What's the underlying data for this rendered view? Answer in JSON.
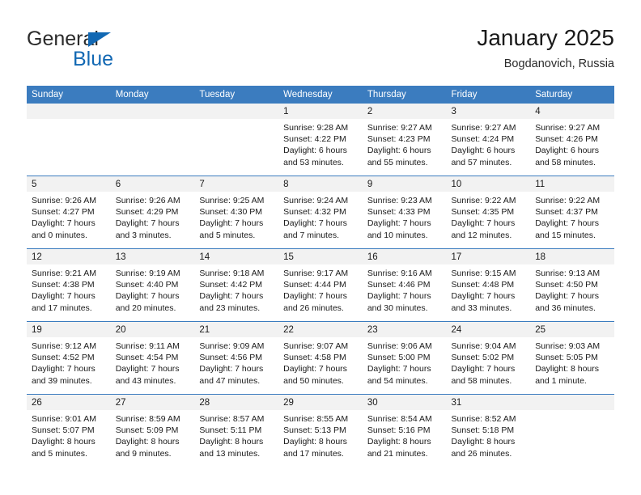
{
  "brand": {
    "name_top": "General",
    "name_bottom": "Blue",
    "color_blue": "#1268b3",
    "color_dark": "#2b2b2b"
  },
  "header": {
    "title": "January 2025",
    "subtitle": "Bogdanovich, Russia"
  },
  "theme": {
    "header_row_bg": "#3b7cbf",
    "header_row_text": "#ffffff",
    "day_band_bg": "#f2f2f2",
    "grid_line": "#3b7cbf"
  },
  "weekday_headers": [
    "Sunday",
    "Monday",
    "Tuesday",
    "Wednesday",
    "Thursday",
    "Friday",
    "Saturday"
  ],
  "weeks": [
    [
      {
        "day": "",
        "empty": true,
        "sunrise": "",
        "sunset": "",
        "daylight_1": "",
        "daylight_2": ""
      },
      {
        "day": "",
        "empty": true,
        "sunrise": "",
        "sunset": "",
        "daylight_1": "",
        "daylight_2": ""
      },
      {
        "day": "",
        "empty": true,
        "sunrise": "",
        "sunset": "",
        "daylight_1": "",
        "daylight_2": ""
      },
      {
        "day": "1",
        "empty": false,
        "sunrise": "Sunrise: 9:28 AM",
        "sunset": "Sunset: 4:22 PM",
        "daylight_1": "Daylight: 6 hours",
        "daylight_2": "and 53 minutes."
      },
      {
        "day": "2",
        "empty": false,
        "sunrise": "Sunrise: 9:27 AM",
        "sunset": "Sunset: 4:23 PM",
        "daylight_1": "Daylight: 6 hours",
        "daylight_2": "and 55 minutes."
      },
      {
        "day": "3",
        "empty": false,
        "sunrise": "Sunrise: 9:27 AM",
        "sunset": "Sunset: 4:24 PM",
        "daylight_1": "Daylight: 6 hours",
        "daylight_2": "and 57 minutes."
      },
      {
        "day": "4",
        "empty": false,
        "sunrise": "Sunrise: 9:27 AM",
        "sunset": "Sunset: 4:26 PM",
        "daylight_1": "Daylight: 6 hours",
        "daylight_2": "and 58 minutes."
      }
    ],
    [
      {
        "day": "5",
        "empty": false,
        "sunrise": "Sunrise: 9:26 AM",
        "sunset": "Sunset: 4:27 PM",
        "daylight_1": "Daylight: 7 hours",
        "daylight_2": "and 0 minutes."
      },
      {
        "day": "6",
        "empty": false,
        "sunrise": "Sunrise: 9:26 AM",
        "sunset": "Sunset: 4:29 PM",
        "daylight_1": "Daylight: 7 hours",
        "daylight_2": "and 3 minutes."
      },
      {
        "day": "7",
        "empty": false,
        "sunrise": "Sunrise: 9:25 AM",
        "sunset": "Sunset: 4:30 PM",
        "daylight_1": "Daylight: 7 hours",
        "daylight_2": "and 5 minutes."
      },
      {
        "day": "8",
        "empty": false,
        "sunrise": "Sunrise: 9:24 AM",
        "sunset": "Sunset: 4:32 PM",
        "daylight_1": "Daylight: 7 hours",
        "daylight_2": "and 7 minutes."
      },
      {
        "day": "9",
        "empty": false,
        "sunrise": "Sunrise: 9:23 AM",
        "sunset": "Sunset: 4:33 PM",
        "daylight_1": "Daylight: 7 hours",
        "daylight_2": "and 10 minutes."
      },
      {
        "day": "10",
        "empty": false,
        "sunrise": "Sunrise: 9:22 AM",
        "sunset": "Sunset: 4:35 PM",
        "daylight_1": "Daylight: 7 hours",
        "daylight_2": "and 12 minutes."
      },
      {
        "day": "11",
        "empty": false,
        "sunrise": "Sunrise: 9:22 AM",
        "sunset": "Sunset: 4:37 PM",
        "daylight_1": "Daylight: 7 hours",
        "daylight_2": "and 15 minutes."
      }
    ],
    [
      {
        "day": "12",
        "empty": false,
        "sunrise": "Sunrise: 9:21 AM",
        "sunset": "Sunset: 4:38 PM",
        "daylight_1": "Daylight: 7 hours",
        "daylight_2": "and 17 minutes."
      },
      {
        "day": "13",
        "empty": false,
        "sunrise": "Sunrise: 9:19 AM",
        "sunset": "Sunset: 4:40 PM",
        "daylight_1": "Daylight: 7 hours",
        "daylight_2": "and 20 minutes."
      },
      {
        "day": "14",
        "empty": false,
        "sunrise": "Sunrise: 9:18 AM",
        "sunset": "Sunset: 4:42 PM",
        "daylight_1": "Daylight: 7 hours",
        "daylight_2": "and 23 minutes."
      },
      {
        "day": "15",
        "empty": false,
        "sunrise": "Sunrise: 9:17 AM",
        "sunset": "Sunset: 4:44 PM",
        "daylight_1": "Daylight: 7 hours",
        "daylight_2": "and 26 minutes."
      },
      {
        "day": "16",
        "empty": false,
        "sunrise": "Sunrise: 9:16 AM",
        "sunset": "Sunset: 4:46 PM",
        "daylight_1": "Daylight: 7 hours",
        "daylight_2": "and 30 minutes."
      },
      {
        "day": "17",
        "empty": false,
        "sunrise": "Sunrise: 9:15 AM",
        "sunset": "Sunset: 4:48 PM",
        "daylight_1": "Daylight: 7 hours",
        "daylight_2": "and 33 minutes."
      },
      {
        "day": "18",
        "empty": false,
        "sunrise": "Sunrise: 9:13 AM",
        "sunset": "Sunset: 4:50 PM",
        "daylight_1": "Daylight: 7 hours",
        "daylight_2": "and 36 minutes."
      }
    ],
    [
      {
        "day": "19",
        "empty": false,
        "sunrise": "Sunrise: 9:12 AM",
        "sunset": "Sunset: 4:52 PM",
        "daylight_1": "Daylight: 7 hours",
        "daylight_2": "and 39 minutes."
      },
      {
        "day": "20",
        "empty": false,
        "sunrise": "Sunrise: 9:11 AM",
        "sunset": "Sunset: 4:54 PM",
        "daylight_1": "Daylight: 7 hours",
        "daylight_2": "and 43 minutes."
      },
      {
        "day": "21",
        "empty": false,
        "sunrise": "Sunrise: 9:09 AM",
        "sunset": "Sunset: 4:56 PM",
        "daylight_1": "Daylight: 7 hours",
        "daylight_2": "and 47 minutes."
      },
      {
        "day": "22",
        "empty": false,
        "sunrise": "Sunrise: 9:07 AM",
        "sunset": "Sunset: 4:58 PM",
        "daylight_1": "Daylight: 7 hours",
        "daylight_2": "and 50 minutes."
      },
      {
        "day": "23",
        "empty": false,
        "sunrise": "Sunrise: 9:06 AM",
        "sunset": "Sunset: 5:00 PM",
        "daylight_1": "Daylight: 7 hours",
        "daylight_2": "and 54 minutes."
      },
      {
        "day": "24",
        "empty": false,
        "sunrise": "Sunrise: 9:04 AM",
        "sunset": "Sunset: 5:02 PM",
        "daylight_1": "Daylight: 7 hours",
        "daylight_2": "and 58 minutes."
      },
      {
        "day": "25",
        "empty": false,
        "sunrise": "Sunrise: 9:03 AM",
        "sunset": "Sunset: 5:05 PM",
        "daylight_1": "Daylight: 8 hours",
        "daylight_2": "and 1 minute."
      }
    ],
    [
      {
        "day": "26",
        "empty": false,
        "sunrise": "Sunrise: 9:01 AM",
        "sunset": "Sunset: 5:07 PM",
        "daylight_1": "Daylight: 8 hours",
        "daylight_2": "and 5 minutes."
      },
      {
        "day": "27",
        "empty": false,
        "sunrise": "Sunrise: 8:59 AM",
        "sunset": "Sunset: 5:09 PM",
        "daylight_1": "Daylight: 8 hours",
        "daylight_2": "and 9 minutes."
      },
      {
        "day": "28",
        "empty": false,
        "sunrise": "Sunrise: 8:57 AM",
        "sunset": "Sunset: 5:11 PM",
        "daylight_1": "Daylight: 8 hours",
        "daylight_2": "and 13 minutes."
      },
      {
        "day": "29",
        "empty": false,
        "sunrise": "Sunrise: 8:55 AM",
        "sunset": "Sunset: 5:13 PM",
        "daylight_1": "Daylight: 8 hours",
        "daylight_2": "and 17 minutes."
      },
      {
        "day": "30",
        "empty": false,
        "sunrise": "Sunrise: 8:54 AM",
        "sunset": "Sunset: 5:16 PM",
        "daylight_1": "Daylight: 8 hours",
        "daylight_2": "and 21 minutes."
      },
      {
        "day": "31",
        "empty": false,
        "sunrise": "Sunrise: 8:52 AM",
        "sunset": "Sunset: 5:18 PM",
        "daylight_1": "Daylight: 8 hours",
        "daylight_2": "and 26 minutes."
      },
      {
        "day": "",
        "empty": true,
        "sunrise": "",
        "sunset": "",
        "daylight_1": "",
        "daylight_2": ""
      }
    ]
  ]
}
